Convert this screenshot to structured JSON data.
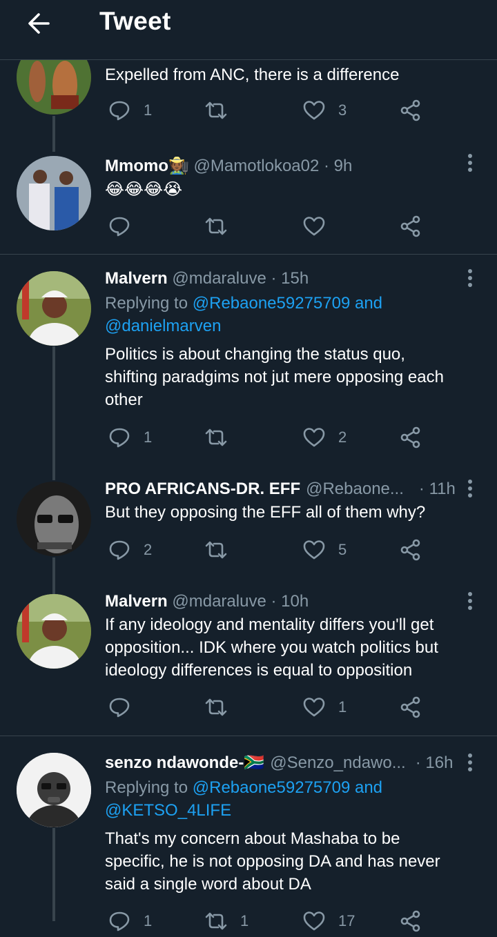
{
  "header": {
    "title": "Tweet"
  },
  "tweets": [
    {
      "text": "Expelled from ANC, there is a difference",
      "actions": {
        "replies": "1",
        "retweets": "",
        "likes": "3"
      }
    },
    {
      "name": "Mmomo🧑🏾‍🌾",
      "handle": "@Mamotlokoa02",
      "time": "· 9h",
      "text": "😂😂😂😭",
      "actions": {
        "replies": "",
        "retweets": "",
        "likes": ""
      }
    },
    {
      "name": "Malvern",
      "handle": "@mdaraluve",
      "time": "· 15h",
      "replying_prefix": "Replying to",
      "mention1": "@Rebaone59275709",
      "and": "and",
      "mention2": "@danielmarven",
      "text_lines": [
        "Politics is about changing the status quo,",
        "shifting paradgims not jut mere opposing each",
        "other"
      ],
      "actions": {
        "replies": "1",
        "retweets": "",
        "likes": "2"
      }
    },
    {
      "name": "PRO AFRICANS-DR. EFF",
      "handle": "@Rebaone...",
      "time": "· 11h",
      "text": "But they opposing the EFF all of them why?",
      "actions": {
        "replies": "2",
        "retweets": "",
        "likes": "5"
      }
    },
    {
      "name": "Malvern",
      "handle": "@mdaraluve",
      "time": "· 10h",
      "text_lines": [
        "If any ideology and mentality differs you'll get",
        "opposition... IDK where you watch politics but",
        "ideology differences is equal to opposition"
      ],
      "actions": {
        "replies": "",
        "retweets": "",
        "likes": "1"
      }
    },
    {
      "name": "senzo ndawonde-🇿🇦",
      "handle": "@Senzo_ndawo...",
      "time": "· 16h",
      "replying_prefix": "Replying to",
      "mention1": "@Rebaone59275709",
      "and": "and",
      "mention2": "@KETSO_4LIFE",
      "text_lines": [
        "That's my concern about Mashaba to be",
        "specific, he is not opposing DA and has never",
        "said a single word about DA"
      ],
      "actions": {
        "replies": "1",
        "retweets": "1",
        "likes": "17"
      }
    }
  ],
  "colors": {
    "background": "#15202b",
    "muted": "#8899a6",
    "link": "#1da1f2",
    "divider": "#38444d"
  }
}
